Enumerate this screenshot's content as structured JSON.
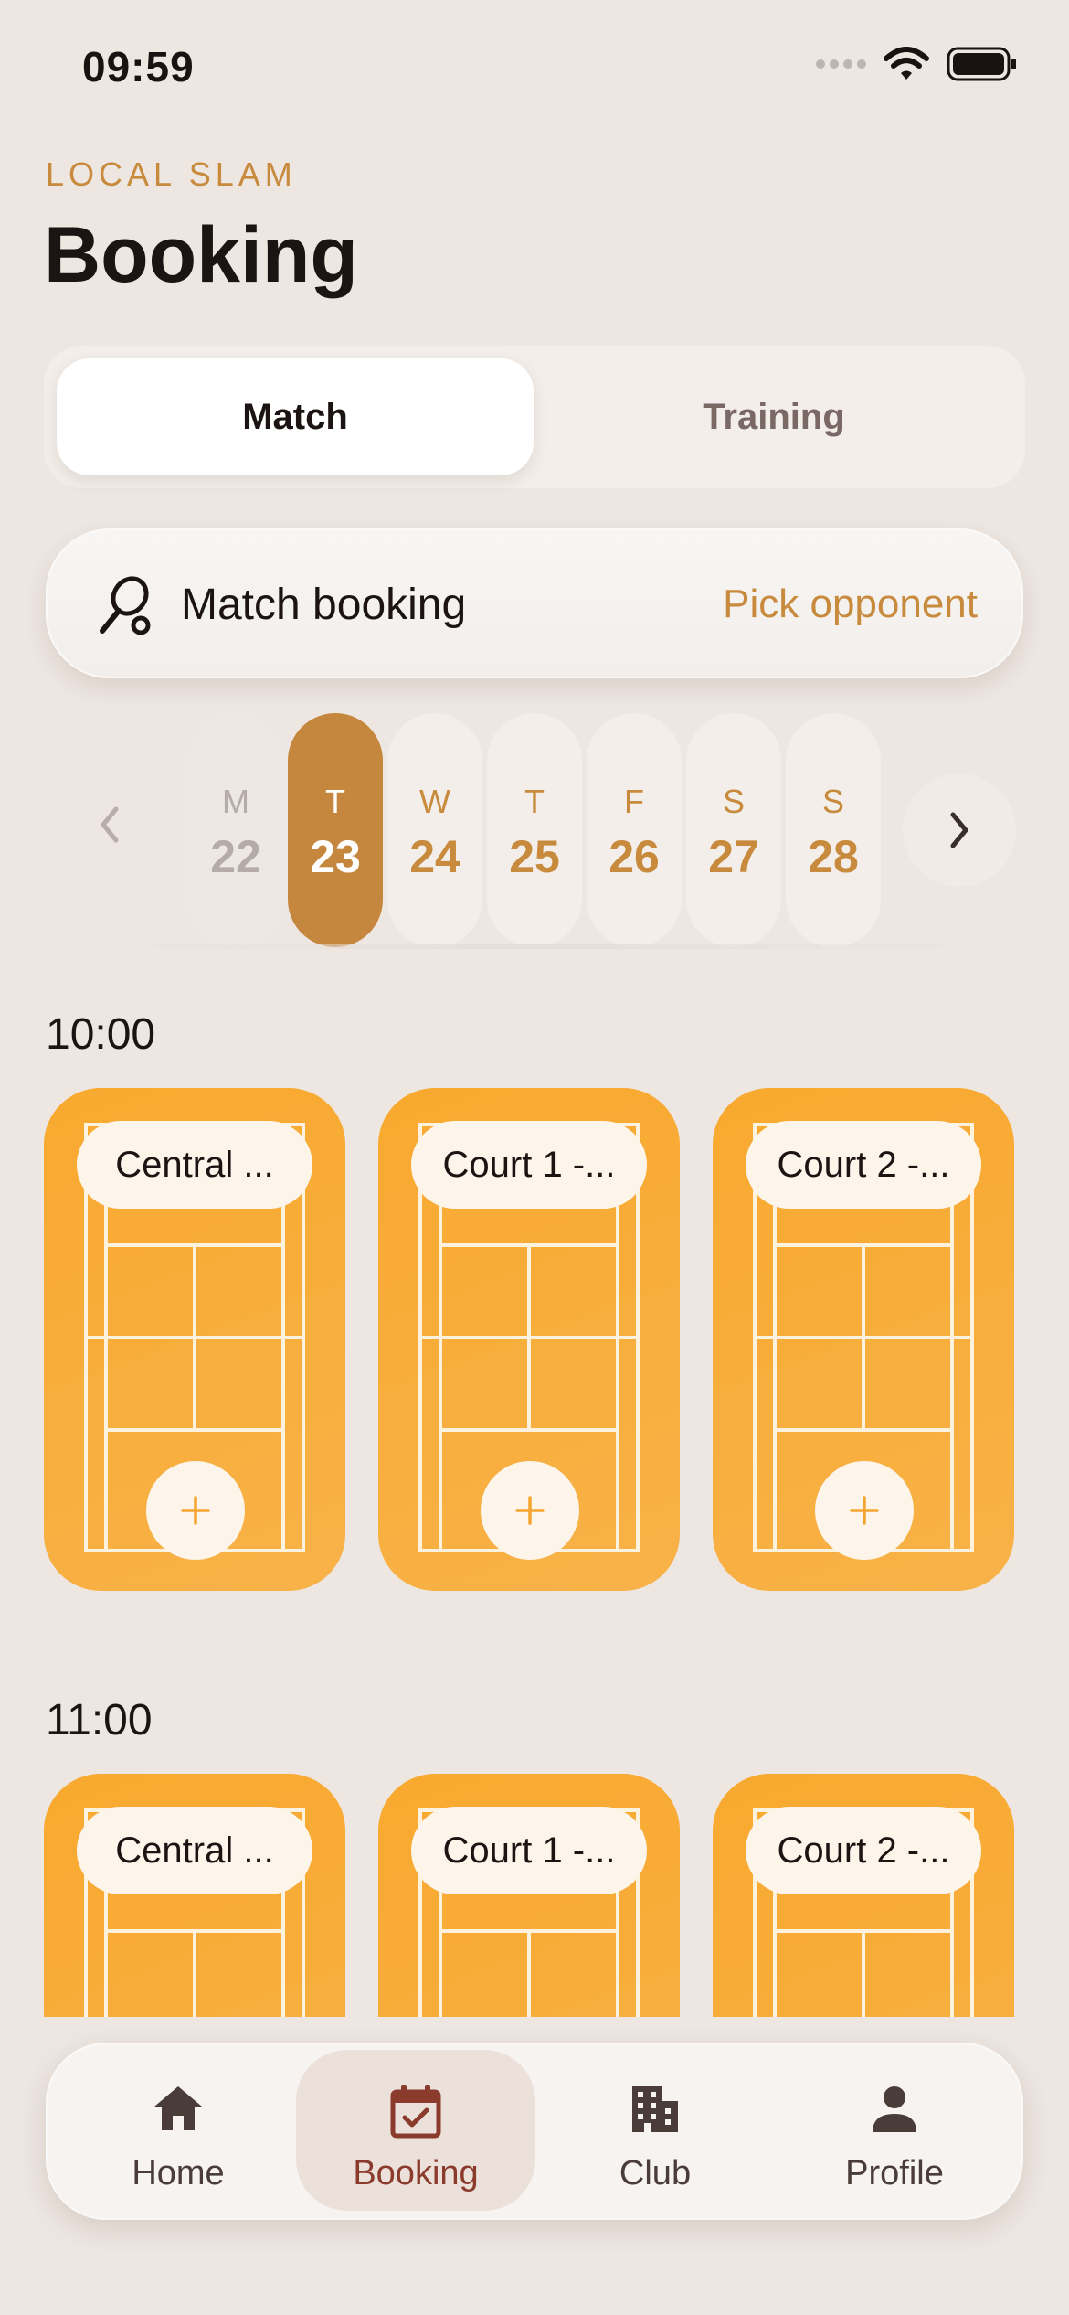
{
  "status": {
    "time": "09:59"
  },
  "header": {
    "eyebrow": "LOCAL SLAM",
    "title": "Booking"
  },
  "segmented": {
    "options": [
      "Match",
      "Training"
    ],
    "selected": "Match"
  },
  "booking_card": {
    "title": "Match booking",
    "action": "Pick opponent",
    "icon": "racket-icon"
  },
  "dates": [
    {
      "weekday": "M",
      "day": "22",
      "state": "disabled"
    },
    {
      "weekday": "T",
      "day": "23",
      "state": "selected"
    },
    {
      "weekday": "W",
      "day": "24",
      "state": "available"
    },
    {
      "weekday": "T",
      "day": "25",
      "state": "available"
    },
    {
      "weekday": "F",
      "day": "26",
      "state": "available"
    },
    {
      "weekday": "S",
      "day": "27",
      "state": "available"
    },
    {
      "weekday": "S",
      "day": "28",
      "state": "available"
    }
  ],
  "slots": [
    {
      "time": "10:00",
      "courts": [
        "Central ...",
        "Court 1 -...",
        "Court 2 -..."
      ]
    },
    {
      "time": "11:00",
      "courts": [
        "Central ...",
        "Court 1 -...",
        "Court 2 -..."
      ]
    }
  ],
  "tabbar": {
    "items": [
      {
        "label": "Home",
        "icon": "home-icon"
      },
      {
        "label": "Booking",
        "icon": "calendar-check-icon"
      },
      {
        "label": "Club",
        "icon": "building-icon"
      },
      {
        "label": "Profile",
        "icon": "person-icon"
      }
    ],
    "active": "Booking"
  },
  "colors": {
    "accent": "#c5873d",
    "court": "#f8a92f",
    "background": "#ede6e1",
    "active_tab": "#8a3b2c"
  }
}
